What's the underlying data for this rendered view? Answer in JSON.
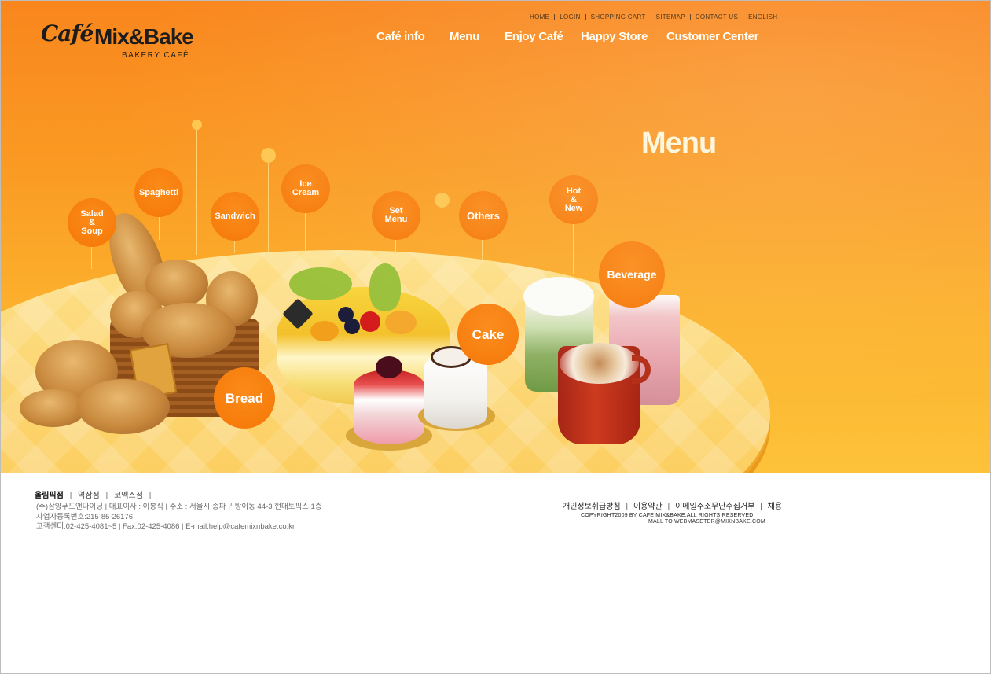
{
  "brand": {
    "script": "Café",
    "name": "Mix&Bake",
    "tagline": "BAKERY CAFÉ"
  },
  "util_nav": [
    "HOME",
    "LOGIN",
    "SHOPPING CART",
    "SITEMAP",
    "CONTACT US",
    "ENGLISH"
  ],
  "main_nav": [
    "Café info",
    "Menu",
    "Enjoy Café",
    "Happy Store",
    "Customer Center"
  ],
  "hero": {
    "title": "Menu"
  },
  "categories": {
    "salad": "Salad\n&\nSoup",
    "spaghetti": "Spaghetti",
    "sandwich": "Sandwich",
    "ice_cream": "Ice\nCream",
    "set_menu": "Set\nMenu",
    "others": "Others",
    "hot_new": "Hot\n&\nNew",
    "beverage": "Beverage",
    "cake": "Cake",
    "bread": "Bread"
  },
  "colors": {
    "hero_top": "#f9861d",
    "hero_bottom": "#fdc23a",
    "bubble": "#f77d0c",
    "table": "#fcd166"
  },
  "footer": {
    "branches": [
      "올림픽점",
      "역삼점",
      "코엑스점"
    ],
    "company_lines": [
      "(주)삼양푸드앤다이닝 | 대표이사 : 이봉식 | 주소 : 서울시 송파구 방이동 44-3 현대토픽스 1층",
      "사업자등록번호:215-85-26176",
      "고객센터:02-425-4081~5 | Fax:02-425-4086 | E-mail:help@cafemixnbake.co.kr"
    ],
    "policies": [
      "개인정보취급방침",
      "이용약관",
      "이메일주소무단수집거부",
      "채용"
    ],
    "copyright": "COPYRIGHT2009 BY CAFE MIX&BAKE.ALL RIGHTS RESERVED.",
    "mailto": "MALL TO WEBMASETER@MIXNBAKE.COM"
  }
}
